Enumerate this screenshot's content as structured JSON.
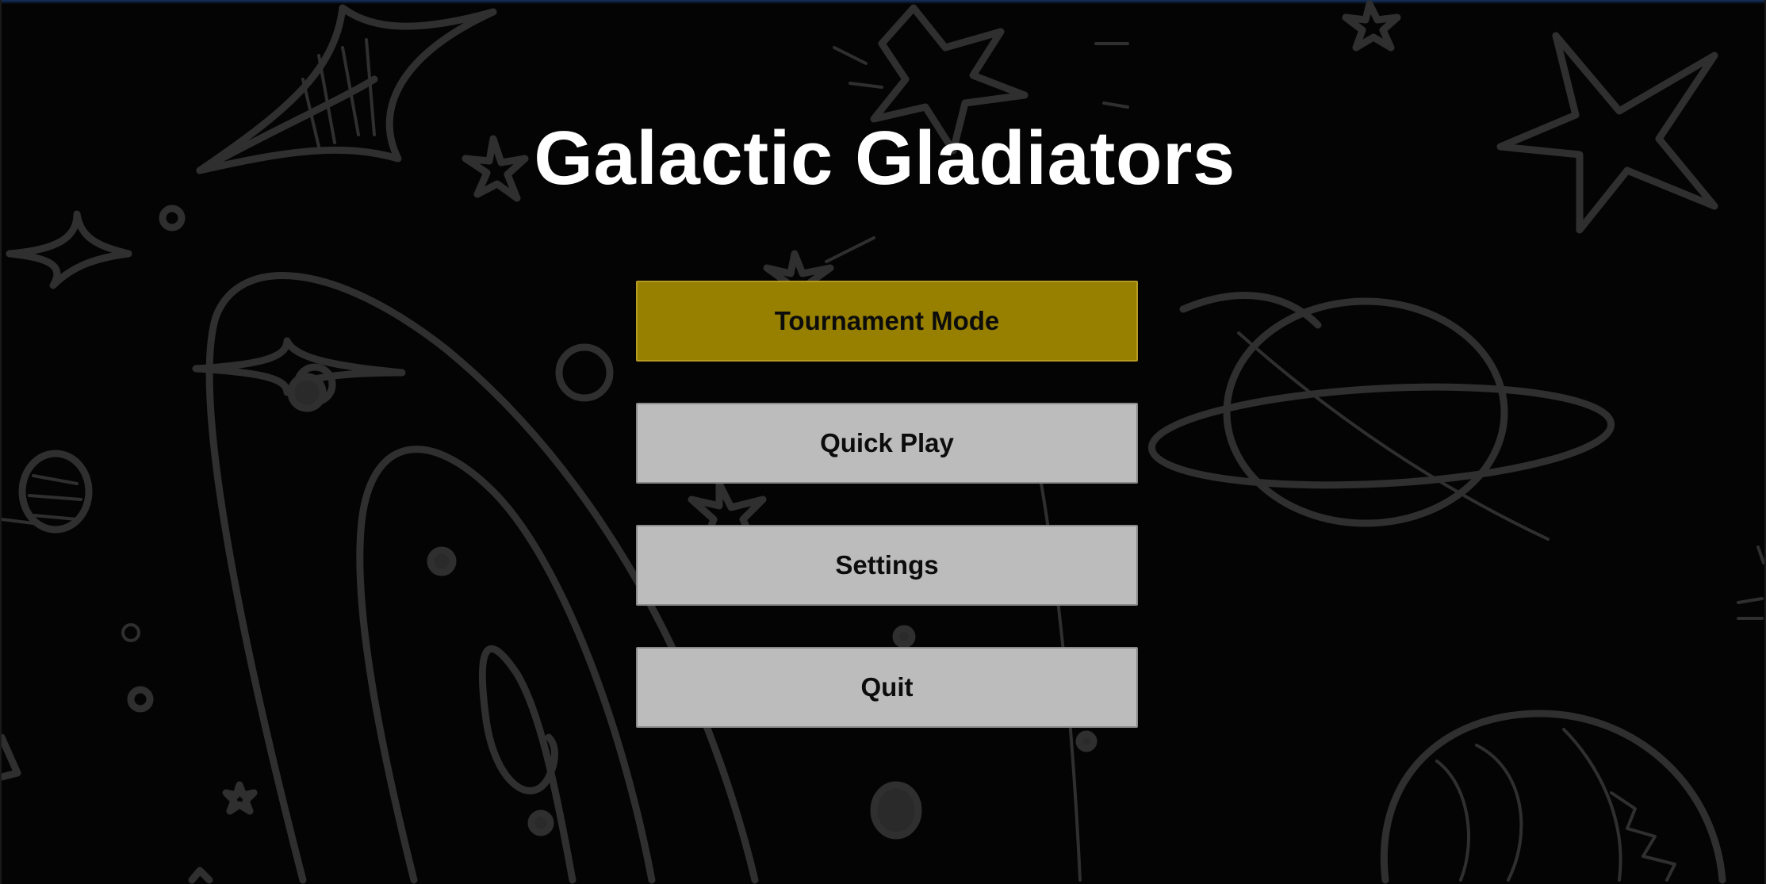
{
  "game": {
    "title": "Galactic Gladiators"
  },
  "menu": {
    "items": [
      {
        "label": "Tournament Mode",
        "selected": true
      },
      {
        "label": "Quick Play",
        "selected": false
      },
      {
        "label": "Settings",
        "selected": false
      },
      {
        "label": "Quit",
        "selected": false
      }
    ]
  },
  "colors": {
    "background": "#040404",
    "doodle_stroke": "#2f2f2f",
    "title_text": "#ffffff",
    "selected_button": "#978000",
    "button": "#bcbcbc",
    "button_text": "#0c0c0c"
  },
  "decorations": [
    "star-doodles",
    "planet-doodle",
    "spiral-galaxy-doodle",
    "sparkle-doodles"
  ]
}
